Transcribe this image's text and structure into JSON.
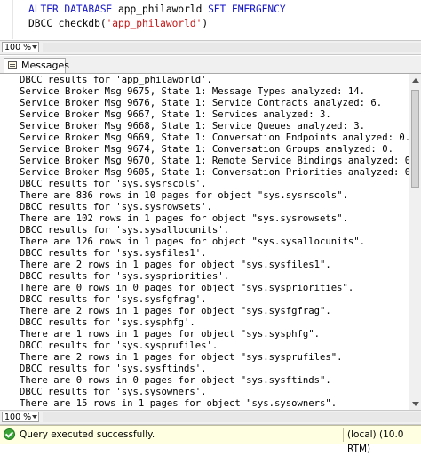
{
  "editor": {
    "line1": {
      "kw1": "ALTER DATABASE",
      "name": " app_philaworld ",
      "kw2": "SET EMERGENCY"
    },
    "line2": {
      "name": "DBCC checkdb(",
      "str": "'app_philaworld'",
      "close": ")"
    }
  },
  "zoom_top": "100 %",
  "tabs": [
    {
      "label": "Messages"
    }
  ],
  "messages": [
    "DBCC results for 'app_philaworld'.",
    "Service Broker Msg 9675, State 1: Message Types analyzed: 14.",
    "Service Broker Msg 9676, State 1: Service Contracts analyzed: 6.",
    "Service Broker Msg 9667, State 1: Services analyzed: 3.",
    "Service Broker Msg 9668, State 1: Service Queues analyzed: 3.",
    "Service Broker Msg 9669, State 1: Conversation Endpoints analyzed: 0.",
    "Service Broker Msg 9674, State 1: Conversation Groups analyzed: 0.",
    "Service Broker Msg 9670, State 1: Remote Service Bindings analyzed: 0.",
    "Service Broker Msg 9605, State 1: Conversation Priorities analyzed: 0.",
    "DBCC results for 'sys.sysrscols'.",
    "There are 836 rows in 10 pages for object \"sys.sysrscols\".",
    "DBCC results for 'sys.sysrowsets'.",
    "There are 102 rows in 1 pages for object \"sys.sysrowsets\".",
    "DBCC results for 'sys.sysallocunits'.",
    "There are 126 rows in 1 pages for object \"sys.sysallocunits\".",
    "DBCC results for 'sys.sysfiles1'.",
    "There are 2 rows in 1 pages for object \"sys.sysfiles1\".",
    "DBCC results for 'sys.syspriorities'.",
    "There are 0 rows in 0 pages for object \"sys.syspriorities\".",
    "DBCC results for 'sys.sysfgfrag'.",
    "There are 2 rows in 1 pages for object \"sys.sysfgfrag\".",
    "DBCC results for 'sys.sysphfg'.",
    "There are 1 rows in 1 pages for object \"sys.sysphfg\".",
    "DBCC results for 'sys.sysprufiles'.",
    "There are 2 rows in 1 pages for object \"sys.sysprufiles\".",
    "DBCC results for 'sys.sysftinds'.",
    "There are 0 rows in 0 pages for object \"sys.sysftinds\".",
    "DBCC results for 'sys.sysowners'.",
    "There are 15 rows in 1 pages for object \"sys.sysowners\"."
  ],
  "zoom_bottom": "100 %",
  "status": {
    "text": "Query executed successfully.",
    "server": "(local) (10.0 RTM)",
    "colors": {
      "background": "#ffffe1",
      "ok": "#3aa335"
    }
  }
}
